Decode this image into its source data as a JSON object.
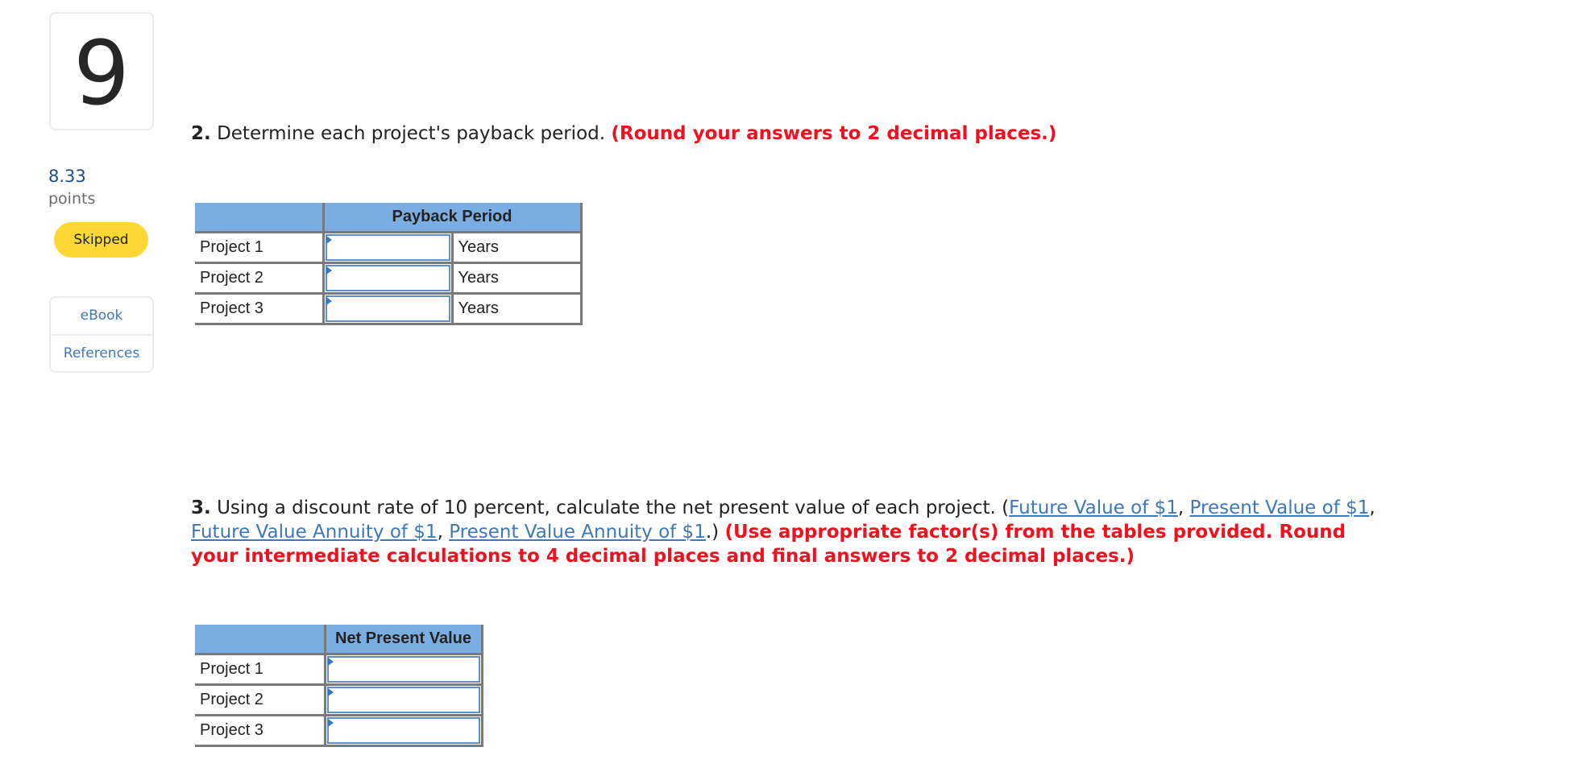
{
  "sidebar": {
    "question_number": "9",
    "points_value": "8.33",
    "points_label": "points",
    "status": "Skipped",
    "status_color": "#fdd835",
    "resources": [
      {
        "label": "eBook"
      },
      {
        "label": "References"
      }
    ]
  },
  "question2": {
    "number": "2.",
    "text": "Determine each project's payback period.",
    "instruction": "(Round your answers to 2 decimal places.)",
    "table": {
      "header": "Payback Period",
      "rows": [
        {
          "label": "Project 1",
          "value": "",
          "unit": "Years"
        },
        {
          "label": "Project 2",
          "value": "",
          "unit": "Years"
        },
        {
          "label": "Project 3",
          "value": "",
          "unit": "Years"
        }
      ]
    }
  },
  "question3": {
    "number": "3.",
    "text": "Using a discount rate of 10 percent, calculate the net present value of each project.",
    "open_paren": "(",
    "links": [
      "Future Value of $1",
      "Present Value of $1",
      "Future Value Annuity of $1",
      "Present Value Annuity of $1"
    ],
    "link_separator": ", ",
    "close_paren": ".)",
    "instruction": "(Use appropriate factor(s) from the tables provided. Round your intermediate calculations to 4 decimal places and final answers to 2 decimal places.)",
    "table": {
      "header": "Net Present Value",
      "rows": [
        {
          "label": "Project 1",
          "value": ""
        },
        {
          "label": "Project 2",
          "value": ""
        },
        {
          "label": "Project 3",
          "value": ""
        }
      ]
    }
  },
  "colors": {
    "table_header": "#7aaee2",
    "link": "#3d78b9",
    "emphasis": "#f0101e",
    "points": "#1b4f8a"
  }
}
